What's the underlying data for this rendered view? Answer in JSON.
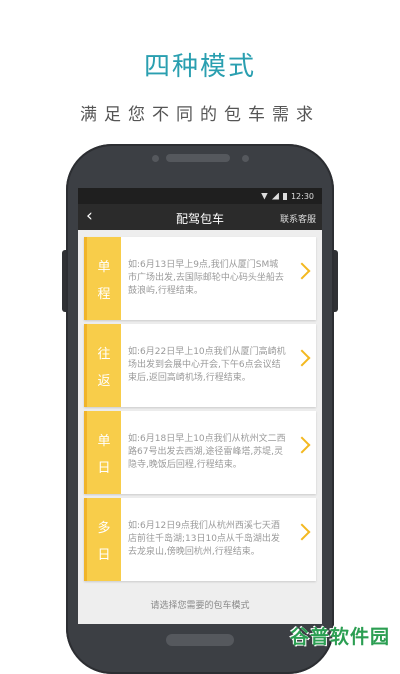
{
  "hero": {
    "title": "四种模式",
    "subtitle": "满足您不同的包车需求"
  },
  "status_bar": {
    "time": "12:30"
  },
  "navbar": {
    "back_icon": "‹",
    "title": "配驾包车",
    "service": "联系客服"
  },
  "cards": [
    {
      "tag1": "单",
      "tag2": "程",
      "desc": "如:6月13日早上9点,我们从厦门SM城市广场出发,去国际邮轮中心码头坐船去鼓浪屿,行程结束。"
    },
    {
      "tag1": "往",
      "tag2": "返",
      "desc": "如:6月22日早上10点我们从厦门高崎机场出发到会展中心开会,下午6点会议结束后,返回高崎机场,行程结束。"
    },
    {
      "tag1": "单",
      "tag2": "日",
      "desc": "如:6月18日早上10点我们从杭州文二西路67号出发去西湖,途径雷峰塔,苏堤,灵隐寺,晚饭后回程,行程结束。"
    },
    {
      "tag1": "多",
      "tag2": "日",
      "desc": "如:6月12日9点我们从杭州西溪七天酒店前往千岛湖;13日10点从千岛湖出发去龙泉山,傍晚回杭州,行程结束。"
    }
  ],
  "footer_hint": "请选择您需要的包车模式",
  "watermark": "谷普软件园"
}
